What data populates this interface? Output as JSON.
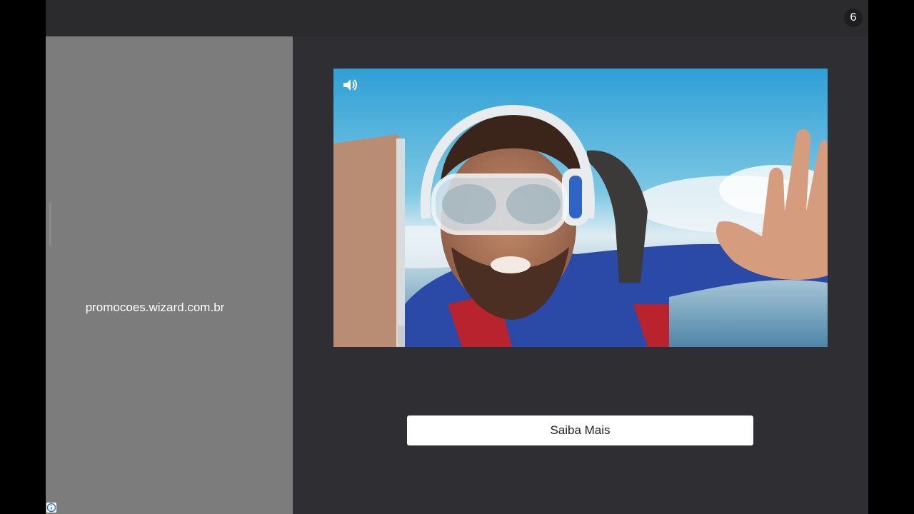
{
  "ad": {
    "countdown": "6",
    "display_url": "promocoes.wizard.com.br",
    "cta_label": "Saiba Mais",
    "video": {
      "subject": "skydiver with goggles and headphones reaching toward laptop",
      "sound_icon": "speaker-icon"
    },
    "info_icon": "info-icon"
  },
  "colors": {
    "frame_bg": "#2f2f33",
    "left_panel_bg": "#7c7c7c",
    "button_bg": "#ffffff",
    "sky": "#3aa0cf"
  }
}
